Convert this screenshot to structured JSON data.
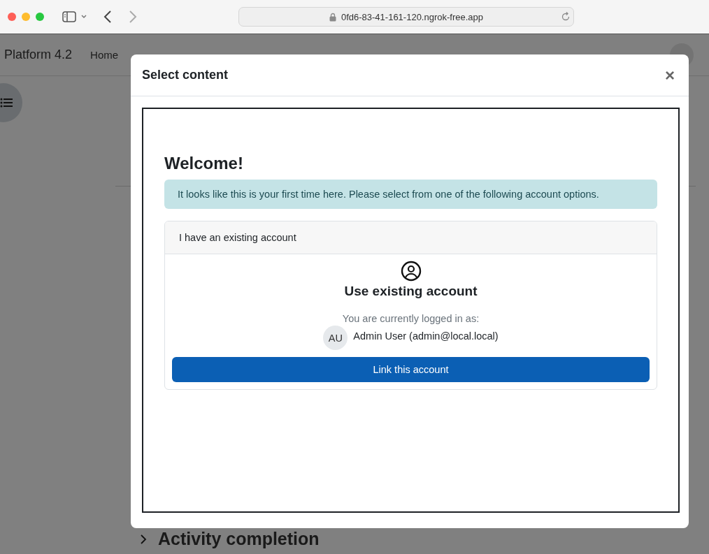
{
  "browser": {
    "url": "0fd6-83-41-161-120.ngrok-free.app"
  },
  "page": {
    "site_name": "Platform 4.2",
    "nav": [
      {
        "label": "Home"
      }
    ],
    "section_heading": "Activity completion"
  },
  "modal": {
    "title": "Select content",
    "close": "×",
    "welcome": "Welcome!",
    "alert": "It looks like this is your first time here. Please select from one of the following account options.",
    "card": {
      "header": "I have an existing account",
      "title": "Use existing account",
      "logged_in_label": "You are currently logged in as:",
      "avatar_initials": "AU",
      "user": "Admin User (admin@local.local)",
      "button": "Link this account"
    }
  }
}
